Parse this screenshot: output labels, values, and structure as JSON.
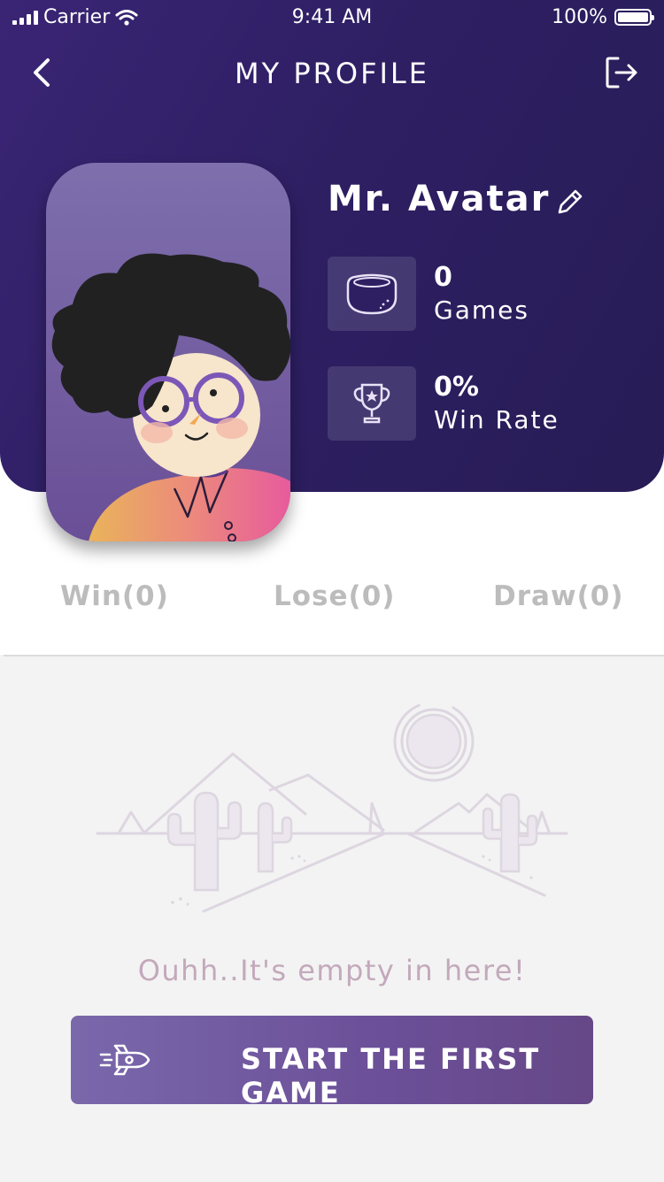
{
  "status_bar": {
    "carrier": "Carrier",
    "time": "9:41 AM",
    "battery": "100%"
  },
  "nav": {
    "title": "MY PROFILE",
    "back_icon": "chevron-left-icon",
    "logout_icon": "logout-icon"
  },
  "profile": {
    "name": "Mr. Avatar",
    "edit_icon": "pencil-icon"
  },
  "stats": [
    {
      "value": "0",
      "label": "Games",
      "icon": "bowl-icon"
    },
    {
      "value": "0%",
      "label": "Win Rate",
      "icon": "trophy-icon"
    }
  ],
  "tabs": [
    {
      "label": "Win(0)"
    },
    {
      "label": "Lose(0)"
    },
    {
      "label": "Draw(0)"
    }
  ],
  "empty_state": {
    "message": "Ouhh..It's empty in here!",
    "button_label": "START THE FIRST GAME",
    "button_icon": "rocket-icon"
  },
  "colors": {
    "header": "#2e1f63",
    "tab_text": "#bcbcbc",
    "empty_text": "#c3a9bb",
    "button": "#6b4f98"
  }
}
